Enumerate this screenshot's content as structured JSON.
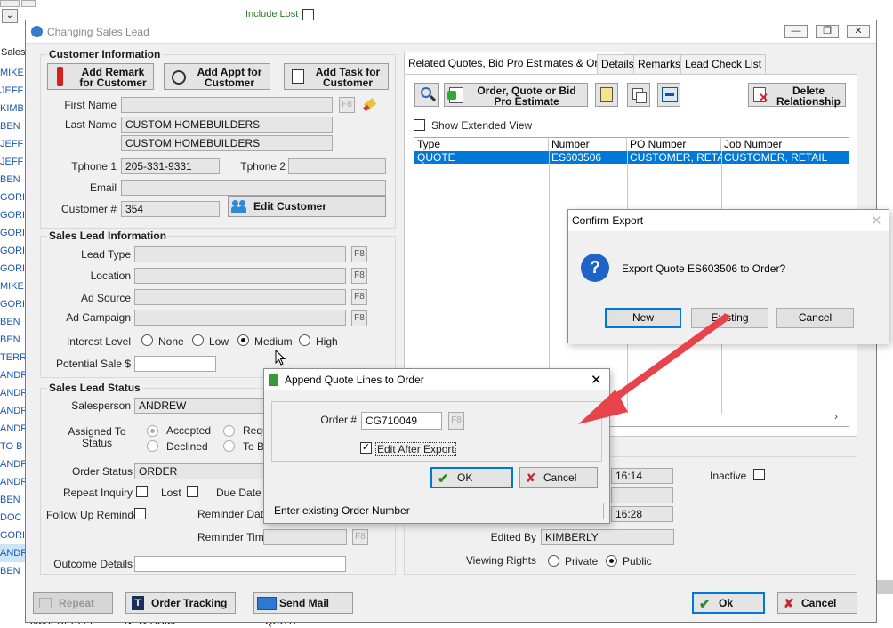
{
  "background": {
    "include_lost_label": "Include Lost",
    "sales_header": "Sales",
    "left_rows": [
      "MIKE",
      "JEFF",
      "KIMB",
      "BEN",
      "JEFF",
      "JEFF",
      "BEN",
      "GORI",
      "GORI",
      "GORI",
      "GORI",
      "GORI",
      "MIKE",
      "GORI",
      "BEN",
      "BEN",
      "TERR",
      "ANDR",
      "ANDR",
      "ANDR",
      "ANDR",
      "TO B",
      "ANDR",
      "ANDR",
      "BEN",
      "DOC",
      "GORI",
      "ANDR",
      "BEN"
    ],
    "bottom_row": [
      "KIMBERLY LEE",
      "NEW HOME",
      "QUOTE"
    ]
  },
  "main_window": {
    "title": "Changing Sales Lead",
    "customer_info": {
      "group_label": "Customer Information",
      "add_remark_label": "Add Remark for Customer",
      "add_appt_label": "Add Appt for Customer",
      "add_task_label": "Add Task for Customer",
      "first_name_label": "First Name",
      "first_name_value": "",
      "last_name_label": "Last Name",
      "last_name_value": "CUSTOM HOMEBUILDERS",
      "last_name_value2": "CUSTOM HOMEBUILDERS",
      "tphone1_label": "Tphone 1",
      "tphone1_value": "205-331-9331",
      "tphone2_label": "Tphone 2",
      "tphone2_value": "",
      "email_label": "Email",
      "email_value": "",
      "customer_num_label": "Customer #",
      "customer_num_value": "354",
      "edit_customer_label": "Edit Customer",
      "f8": "F8"
    },
    "sales_lead_info": {
      "group_label": "Sales Lead Information",
      "lead_type_label": "Lead Type",
      "location_label": "Location",
      "ad_source_label": "Ad Source",
      "ad_campaign_label": "Ad Campaign",
      "interest_level_label": "Interest Level",
      "interest_options": [
        "None",
        "Low",
        "Medium",
        "High"
      ],
      "interest_selected": "Medium",
      "potential_sale_label": "Potential Sale $",
      "f8": "F8"
    },
    "sales_lead_status": {
      "group_label": "Sales Lead Status",
      "salesperson_label": "Salesperson",
      "salesperson_value": "ANDREW",
      "assigned_label": "Assigned To Status",
      "accepted_label": "Accepted",
      "declined_label": "Declined",
      "requ_label": "Requ",
      "tob_label": "To B",
      "order_status_label": "Order Status",
      "order_status_value": "ORDER",
      "repeat_inquiry_label": "Repeat Inquiry",
      "lost_label": "Lost",
      "due_date_label": "Due Date",
      "follow_up_label": "Follow Up Reminder",
      "reminder_date_label": "Reminder Date",
      "reminder_time_label": "Reminder Time",
      "outcome_label": "Outcome Details",
      "f8": "F8"
    },
    "tabs": [
      "Related Quotes, Bid Pro Estimates & Orders",
      "Details",
      "Remarks",
      "Lead Check List"
    ],
    "toolbar": {
      "order_quote_label": "Order, Quote or Bid Pro Estimate",
      "delete_rel_label": "Delete Relationship",
      "show_extended_label": "Show Extended View"
    },
    "grid": {
      "columns": [
        "Type",
        "Number",
        "PO Number",
        "Job Number"
      ],
      "rows": [
        [
          "QUOTE",
          "ES603506",
          "CUSTOMER, RETAIL",
          "CUSTOMER, RETAIL"
        ]
      ]
    },
    "details_right": {
      "time1": "16:14",
      "time2": "16:28",
      "inactive_label": "Inactive",
      "edited_by_label": "Edited By",
      "edited_by_value": "KIMBERLY",
      "viewing_rights_label": "Viewing Rights",
      "private_label": "Private",
      "public_label": "Public"
    },
    "bottom_buttons": {
      "repeat_label": "Repeat",
      "order_tracking_label": "Order Tracking",
      "send_mail_label": "Send Mail",
      "ok_label": "Ok",
      "cancel_label": "Cancel"
    }
  },
  "confirm_export": {
    "title": "Confirm Export",
    "message": "Export Quote ES603506 to Order?",
    "new_label": "New",
    "existing_label": "Existing",
    "cancel_label": "Cancel"
  },
  "append_dialog": {
    "title": "Append Quote Lines to Order",
    "order_num_label": "Order #",
    "order_num_value": "CG710049",
    "f8": "F8",
    "edit_after_export_label": "Edit After Export",
    "edit_after_export_checked": true,
    "ok_label": "OK",
    "cancel_label": "Cancel",
    "status_text": "Enter existing Order Number"
  },
  "colors": {
    "accent": "#0078d7",
    "arrow": "#e8424a"
  }
}
